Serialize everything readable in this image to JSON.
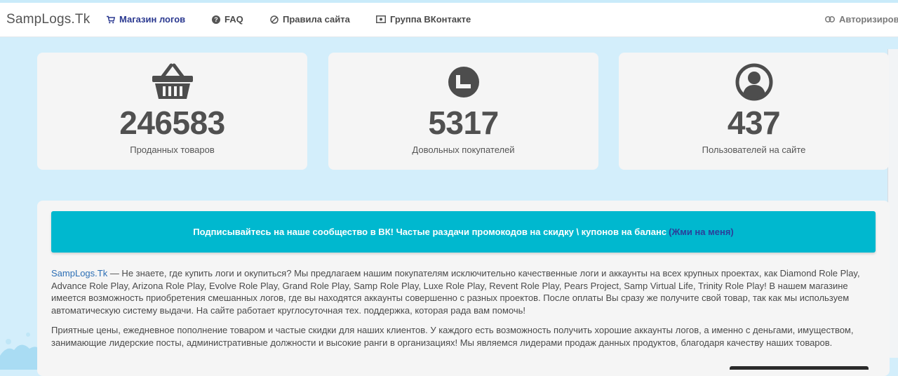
{
  "nav": {
    "brand": "SampLogs.Tk",
    "items": [
      {
        "label": "Магазин логов",
        "icon": "cart-icon"
      },
      {
        "label": "FAQ",
        "icon": "question-circle-icon"
      },
      {
        "label": "Правила сайта",
        "icon": "ban-circle-icon"
      },
      {
        "label": "Группа ВКонтакте",
        "icon": "money-bill-icon"
      }
    ],
    "login": {
      "label": "Авторизирова",
      "icon": "link-icon"
    }
  },
  "stats": [
    {
      "value": "246583",
      "label": "Проданных товаров",
      "icon": "shopping-basket-icon"
    },
    {
      "value": "5317",
      "label": "Довольных покупателей",
      "icon": "clock-icon"
    },
    {
      "value": "437",
      "label": "Пользователей на сайте",
      "icon": "user-circle-icon"
    }
  ],
  "banner": {
    "text": "Подписывайтесь на наше сообщество в ВК! Частые раздачи промокодов на скидку \\ купонов на баланс",
    "link": "(Жми на меня)"
  },
  "about": {
    "brand_link": "SampLogs.Tk",
    "paragraph1": " — Не знаете, где купить логи и окупиться? Мы предлагаем нашим покупателям исключительно качественные логи и аккаунты на всех крупных проектах, как Diamond Role Play, Advance Role Play, Arizona Role Play, Evolve Role Play, Grand Role Play, Samp Role Play, Luxe Role Play, Revent Role Play, Pears Project, Samp Virtual Life, Trinity Role Play! В нашем магазине имеется возможность приобретения смешанных логов, где вы находятся аккаунты совершенно с разных проектов. После оплаты Вы сразу же получите свой товар, так как мы используем автоматическую систему выдачи. На сайте работает круглосуточная тех. поддержка, которая рада вам помочь!",
    "paragraph2": "Приятные цены, ежедневное пополнение товаром и частые скидки для наших клиентов. У каждого есть возможность получить хорошие аккаунты логов, а именно с деньгами, имуществом, занимающие лидерские посты, административные должности и высокие ранги в организациях! Мы являемся лидерами продаж данных продуктов, благодаря качеству наших товаров."
  },
  "colors": {
    "background": "#d3eefb",
    "banner": "#00b8cf",
    "nav_active": "#2b3990",
    "link": "#2d6fb5"
  }
}
